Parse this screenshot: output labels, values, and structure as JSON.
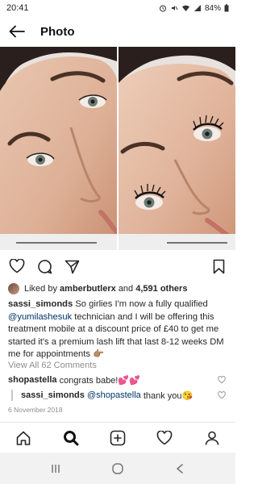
{
  "status_bar": {
    "time": "20:41",
    "battery": "84%"
  },
  "header": {
    "title": "Photo"
  },
  "post": {
    "liked_by_prefix": "Liked by",
    "liked_by_user": "amberbutlerx",
    "liked_by_and": "and",
    "likes_count": "4,591 others",
    "caption_user": "sassi_simonds",
    "caption_part1": "So girlies I'm now a fully qualified",
    "caption_mention": "@yumilashesuk",
    "caption_part2": "technician and I will be offering this treatment mobile at a discount price of £40 to get me started it's a premium lash lift that last 8-12 weeks DM me for appointments",
    "caption_emoji": "👉🏽",
    "view_comments": "View All 62 Comments",
    "date": "6 November 2018"
  },
  "comments": [
    {
      "user": "shopastella",
      "text": "congrats babe!💕💕"
    },
    {
      "user": "sassi_simonds",
      "mention": "@shopastella",
      "text": "thank you😘"
    }
  ],
  "icons": {
    "back": "arrow-left-icon",
    "like": "heart-icon",
    "comment": "comment-icon",
    "share": "paper-plane-icon",
    "save": "bookmark-icon",
    "home": "home-icon",
    "search": "search-icon",
    "add": "add-icon",
    "activity": "heart-icon",
    "profile": "person-icon"
  }
}
